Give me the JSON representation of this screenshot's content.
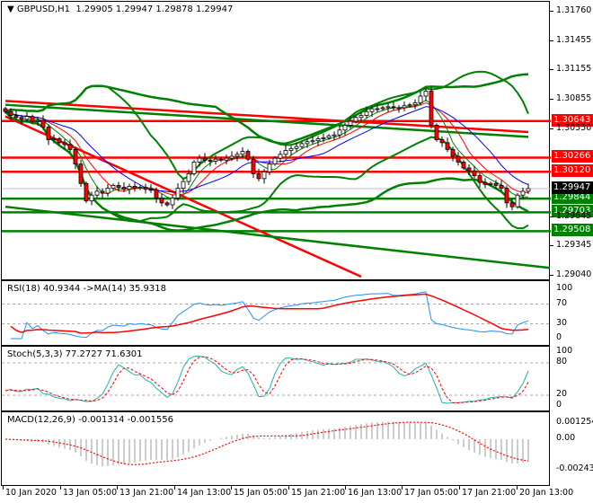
{
  "header": {
    "symbol": "GBPUSD,H1",
    "open": "1.29905",
    "high": "1.29947",
    "low": "1.29878",
    "close": "1.29947"
  },
  "price_axis": [
    "1.31760",
    "1.31455",
    "1.31155",
    "1.30855",
    "1.30550",
    "1.29645",
    "1.29345",
    "1.29040"
  ],
  "levels": [
    {
      "label": "1.30643",
      "value": 1.30643,
      "color": "#ff0000"
    },
    {
      "label": "1.30266",
      "value": 1.30266,
      "color": "#ff0000"
    },
    {
      "label": "1.30120",
      "value": 1.3012,
      "color": "#ff0000"
    },
    {
      "label": "1.29844",
      "value": 1.29844,
      "color": "#008000"
    },
    {
      "label": "1.29703",
      "value": 1.29703,
      "color": "#008000"
    },
    {
      "label": "1.29508",
      "value": 1.29508,
      "color": "#008000"
    }
  ],
  "current_price": {
    "label": "1.29947",
    "value": 1.29947
  },
  "rsi": {
    "title": "RSI(18) 40.9344  ->MA(14) 35.9318",
    "axis": [
      "100",
      "70",
      "30",
      "0"
    ]
  },
  "stoch": {
    "title": "Stoch(5,3,3) 77.2727 71.6301",
    "axis": [
      "100",
      "80",
      "20",
      "0"
    ]
  },
  "macd": {
    "title": "MACD(12,26,9) -0.001314 -0.001556",
    "axis": [
      "0.001254",
      "0.00",
      "-0.002435"
    ]
  },
  "time_labels": [
    "10 Jan 2020",
    "13 Jan 05:00",
    "13 Jan 21:00",
    "14 Jan 13:00",
    "15 Jan 05:00",
    "15 Jan 21:00",
    "16 Jan 13:00",
    "17 Jan 05:00",
    "17 Jan 21:00",
    "20 Jan 13:00"
  ],
  "chart_data": {
    "type": "candlestick",
    "title": "GBPUSD,H1",
    "ylim": [
      1.2904,
      1.3176
    ],
    "colors": {
      "bull": "#000000",
      "bear": "#ff0000",
      "bands": "#008000",
      "ma_fast": "#0000ff",
      "ma_slow": "#ff0000",
      "rsi": "#1e90ff",
      "stoch": "#20b2aa"
    },
    "closes": [
      1.3074,
      1.307,
      1.3068,
      1.3066,
      1.3069,
      1.3064,
      1.3065,
      1.3058,
      1.3045,
      1.3046,
      1.3042,
      1.304,
      1.3035,
      1.302,
      1.3,
      1.2982,
      1.2988,
      1.2992,
      1.299,
      1.2995,
      1.2998,
      1.2996,
      1.2994,
      1.2997,
      1.2995,
      1.2996,
      1.2994,
      1.2993,
      1.2985,
      1.298,
      1.2978,
      1.2985,
      1.2995,
      1.3002,
      1.301,
      1.3022,
      1.3026,
      1.3024,
      1.3023,
      1.3025,
      1.3024,
      1.3026,
      1.3028,
      1.303,
      1.3033,
      1.3025,
      1.301,
      1.3005,
      1.3012,
      1.302,
      1.3026,
      1.303,
      1.3034,
      1.3036,
      1.3038,
      1.3041,
      1.3043,
      1.3044,
      1.3046,
      1.3047,
      1.3049,
      1.305,
      1.3055,
      1.306,
      1.3064,
      1.3068,
      1.307,
      1.3074,
      1.3077,
      1.3077,
      1.3078,
      1.3079,
      1.3078,
      1.3078,
      1.308,
      1.3081,
      1.3083,
      1.309,
      1.3095,
      1.306,
      1.3045,
      1.3042,
      1.3035,
      1.3028,
      1.3022,
      1.3016,
      1.3013,
      1.3008,
      1.3001,
      1.2999,
      1.3,
      1.2998,
      1.2995,
      1.298,
      1.2976,
      1.2988,
      1.2992,
      1.29947
    ],
    "trendlines": [
      {
        "name": "red-downtrend",
        "color": "#ff0000",
        "from": [
          0,
          1.3069
        ],
        "to": [
          66,
          1.2904
        ]
      },
      {
        "name": "green-support-trend",
        "color": "#008000",
        "from": [
          0,
          1.2976
        ],
        "to": [
          101,
          1.2913
        ]
      },
      {
        "name": "red-long-curve",
        "color": "#ff0000",
        "from": [
          0,
          1.3085
        ],
        "to": [
          97,
          1.3053
        ]
      },
      {
        "name": "green-long-curve",
        "color": "#008000",
        "from": [
          0,
          1.3081
        ],
        "to": [
          97,
          1.3048
        ]
      }
    ]
  }
}
